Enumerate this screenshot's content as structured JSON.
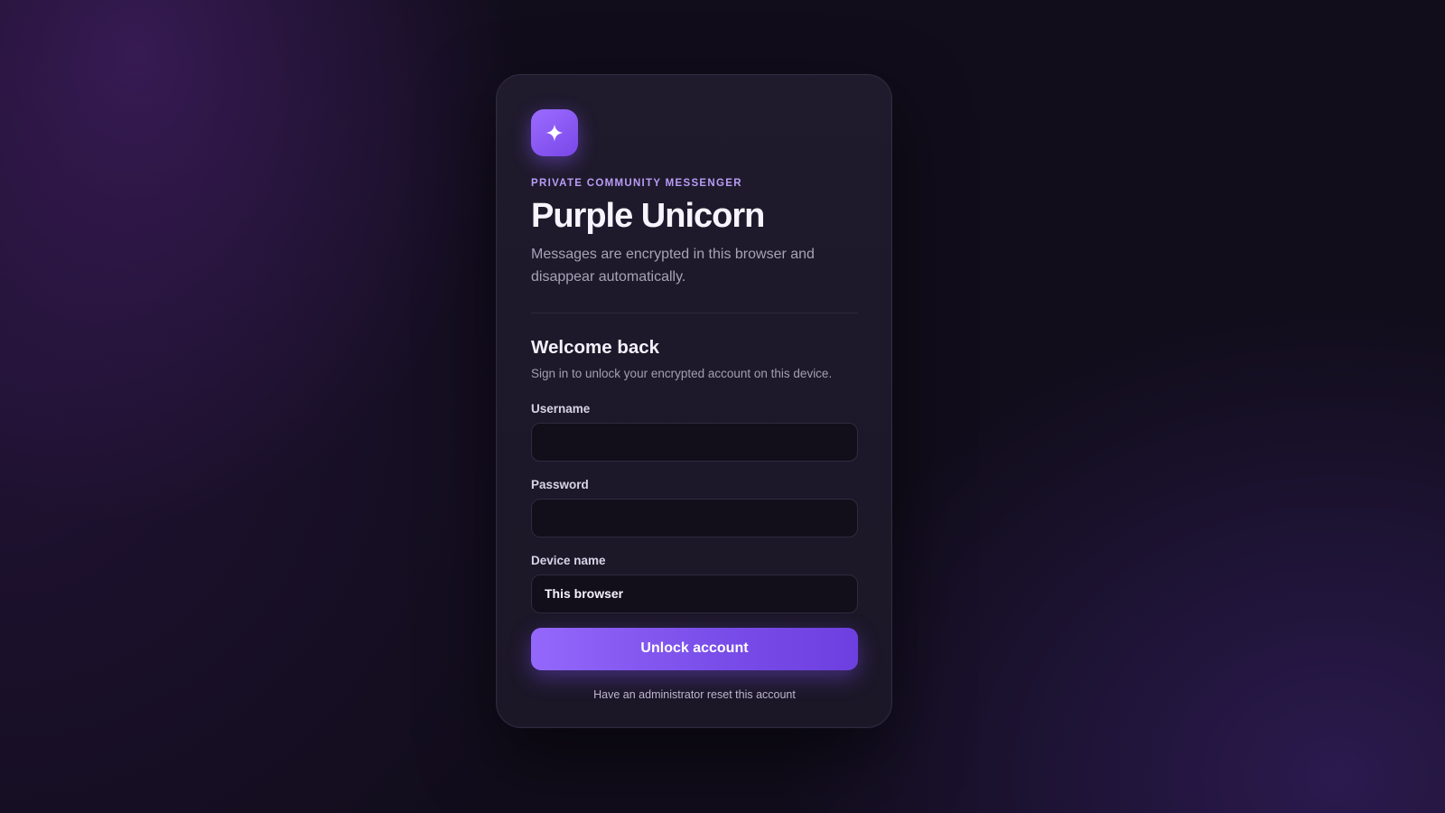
{
  "brand": {
    "icon": "sparkle-icon",
    "eyebrow": "PRIVATE COMMUNITY MESSENGER",
    "title": "Purple Unicorn",
    "tagline": "Messages are encrypted in this browser and disappear automatically."
  },
  "login": {
    "heading": "Welcome back",
    "subheading": "Sign in to unlock your encrypted account on this device.",
    "username": {
      "label": "Username",
      "value": "",
      "placeholder": ""
    },
    "password": {
      "label": "Password",
      "value": "",
      "placeholder": ""
    },
    "device_name": {
      "label": "Device name",
      "value": "This browser",
      "placeholder": ""
    },
    "submit_label": "Unlock account",
    "reset_link": "Have an administrator reset this account"
  },
  "colors": {
    "accent": "#8b5cf6",
    "accent_dark": "#6e3fe0",
    "background": "#110d1b",
    "card": "#1d1829"
  }
}
